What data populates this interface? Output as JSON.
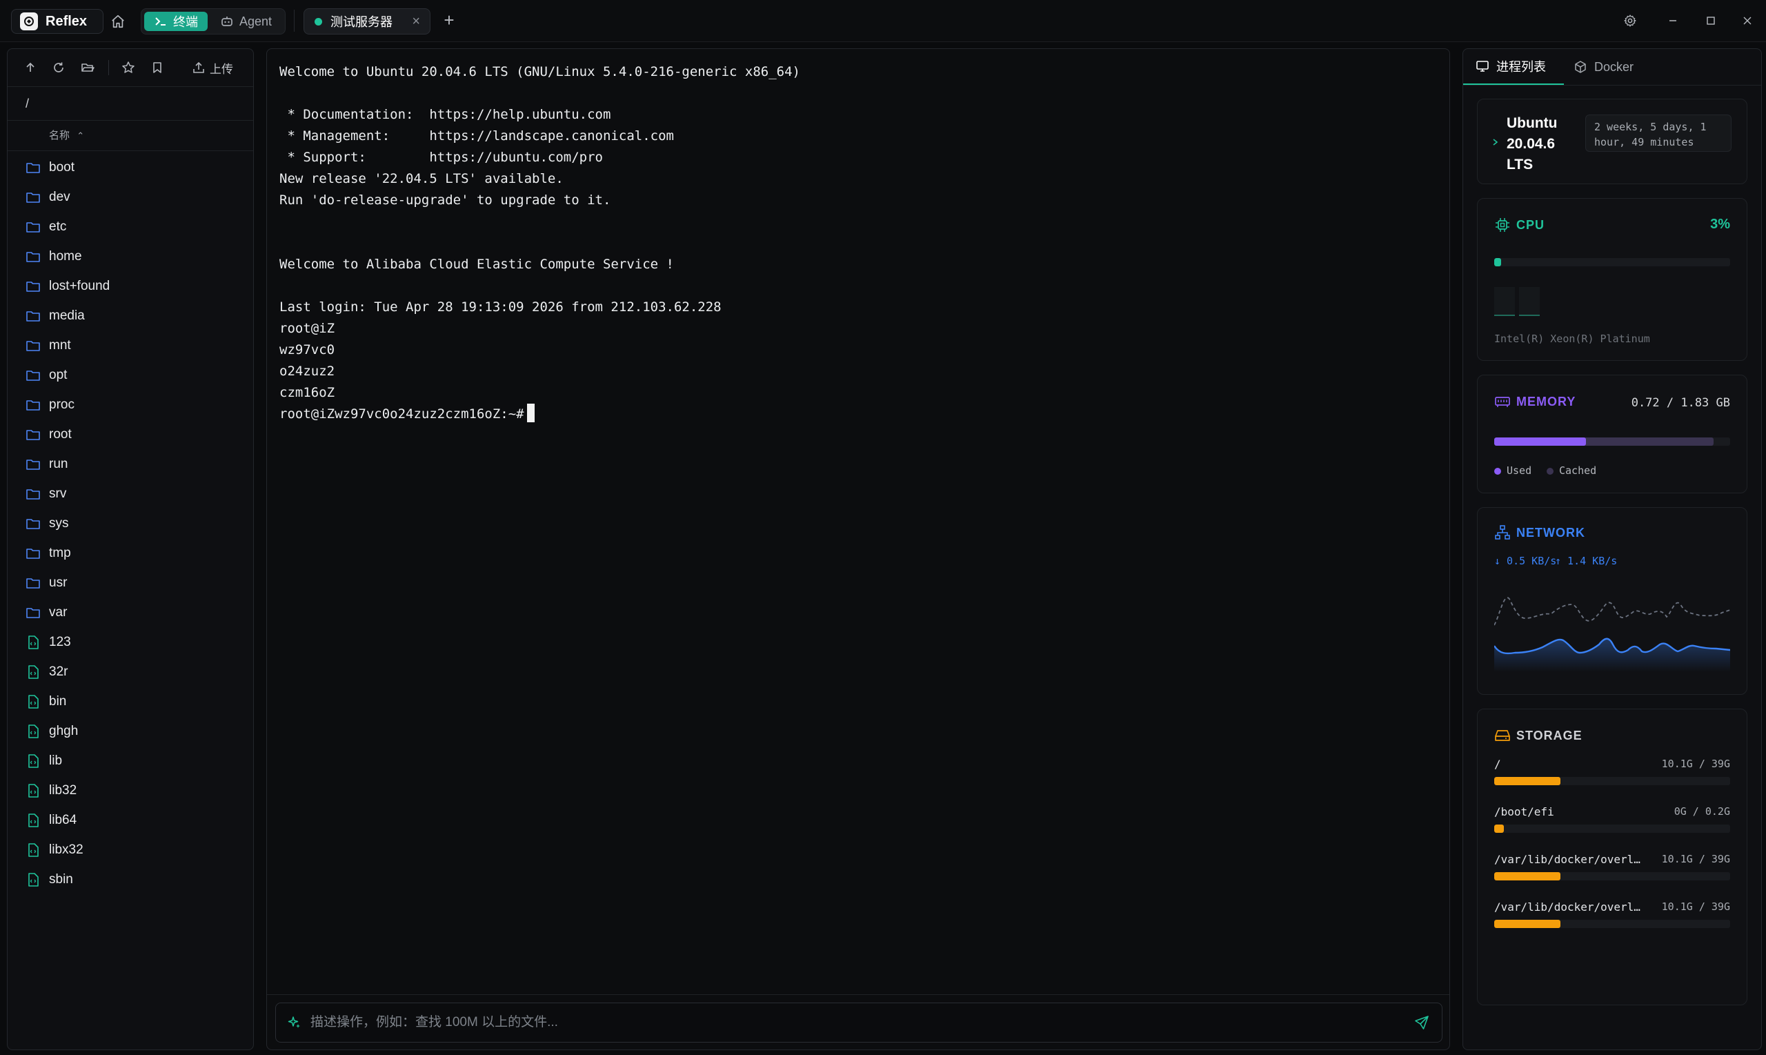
{
  "app": {
    "name": "Reflex"
  },
  "modes": {
    "terminal": "终端",
    "agent": "Agent"
  },
  "tab": {
    "label": "测试服务器",
    "close": "×",
    "add": "+"
  },
  "files": {
    "upload_label": "上传",
    "path": "/",
    "column_name": "名称",
    "sort_glyph": "⌃",
    "items": [
      {
        "name": "boot",
        "type": "folder"
      },
      {
        "name": "dev",
        "type": "folder"
      },
      {
        "name": "etc",
        "type": "folder"
      },
      {
        "name": "home",
        "type": "folder"
      },
      {
        "name": "lost+found",
        "type": "folder"
      },
      {
        "name": "media",
        "type": "folder"
      },
      {
        "name": "mnt",
        "type": "folder"
      },
      {
        "name": "opt",
        "type": "folder"
      },
      {
        "name": "proc",
        "type": "folder"
      },
      {
        "name": "root",
        "type": "folder"
      },
      {
        "name": "run",
        "type": "folder"
      },
      {
        "name": "srv",
        "type": "folder"
      },
      {
        "name": "sys",
        "type": "folder"
      },
      {
        "name": "tmp",
        "type": "folder"
      },
      {
        "name": "usr",
        "type": "folder"
      },
      {
        "name": "var",
        "type": "folder"
      },
      {
        "name": "123",
        "type": "file"
      },
      {
        "name": "32r",
        "type": "file"
      },
      {
        "name": "bin",
        "type": "file"
      },
      {
        "name": "ghgh",
        "type": "file"
      },
      {
        "name": "lib",
        "type": "file"
      },
      {
        "name": "lib32",
        "type": "file"
      },
      {
        "name": "lib64",
        "type": "file"
      },
      {
        "name": "libx32",
        "type": "file"
      },
      {
        "name": "sbin",
        "type": "file"
      }
    ]
  },
  "terminal": {
    "lines": [
      "Welcome to Ubuntu 20.04.6 LTS (GNU/Linux 5.4.0-216-generic x86_64)",
      "",
      " * Documentation:  https://help.ubuntu.com",
      " * Management:     https://landscape.canonical.com",
      " * Support:        https://ubuntu.com/pro",
      "New release '22.04.5 LTS' available.",
      "Run 'do-release-upgrade' to upgrade to it.",
      "",
      "",
      "Welcome to Alibaba Cloud Elastic Compute Service !",
      "",
      "Last login: Tue Apr 28 19:13:09 2026 from 212.103.62.228",
      "root@iZ",
      "wz97vc0",
      "o24zuz2",
      "czm16oZ"
    ],
    "prompt": "root@iZwz97vc0o24zuz2czm16oZ:~#",
    "ai_placeholder": "描述操作，例如：查找 100M 以上的文件..."
  },
  "side": {
    "tabs": {
      "processes": "进程列表",
      "docker": "Docker"
    },
    "system": {
      "os": "Ubuntu 20.04.6 LTS",
      "uptime": "2 weeks, 5 days, 1 hour, 49 minutes"
    },
    "cpu": {
      "title": "CPU",
      "percent_label": "3%",
      "usage_fraction": 0.03,
      "model": "Intel(R) Xeon(R) Platinum",
      "color": "#1fc49b"
    },
    "memory": {
      "title": "MEMORY",
      "usage_label": "0.72 / 1.83 GB",
      "used_fraction": 0.39,
      "cached_fraction": 0.93,
      "legend_used": "Used",
      "legend_cached": "Cached",
      "color_used": "#8b5cf6",
      "color_cached": "#3a3350"
    },
    "network": {
      "title": "NETWORK",
      "down": "↓ 0.5 KB/s",
      "up": "↑ 1.4 KB/s",
      "color": "#3b82f6"
    },
    "storage": {
      "title": "STORAGE",
      "color": "#f59e0b",
      "mounts": [
        {
          "path": "/",
          "usage": "10.1G / 39G",
          "fraction": 0.28
        },
        {
          "path": "/boot/efi",
          "usage": "0G / 0.2G",
          "fraction": 0.04
        },
        {
          "path": "/var/lib/docker/overlay2/...",
          "usage": "10.1G / 39G",
          "fraction": 0.28
        },
        {
          "path": "/var/lib/docker/overlay2/...",
          "usage": "10.1G / 39G",
          "fraction": 0.28
        }
      ]
    }
  }
}
